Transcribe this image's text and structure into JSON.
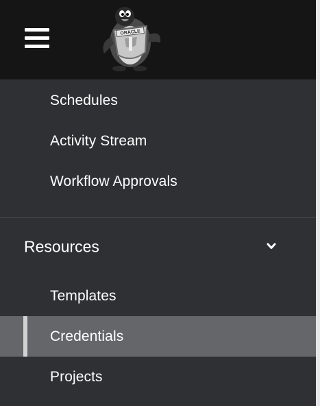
{
  "header": {
    "menu_icon": "hamburger-menu-icon",
    "logo_icon": "oracle-penguin-logo",
    "logo_text": "ORACLE"
  },
  "nav": {
    "top_items": [
      {
        "label": "Schedules"
      },
      {
        "label": "Activity Stream"
      },
      {
        "label": "Workflow Approvals"
      }
    ],
    "resources_group": {
      "label": "Resources",
      "expanded": true,
      "chevron_icon": "chevron-down-icon",
      "items": [
        {
          "label": "Templates",
          "active": false
        },
        {
          "label": "Credentials",
          "active": true
        },
        {
          "label": "Projects",
          "active": false
        }
      ]
    }
  },
  "colors": {
    "header_bg": "#151515",
    "sidebar_bg": "#2f3033",
    "active_item_bg": "#64666a",
    "active_indicator": "#d2d2d2",
    "text": "#ffffff"
  }
}
